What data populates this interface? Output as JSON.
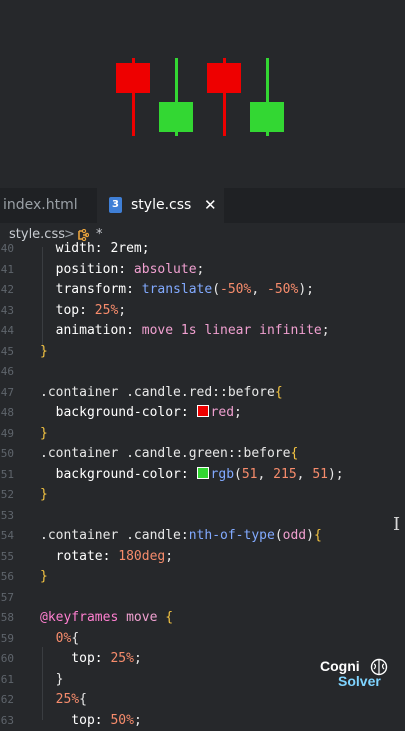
{
  "preview": {
    "colors": {
      "red": "#ee0000",
      "green": "#33d733",
      "background": "#26282b"
    },
    "candles": [
      {
        "color": "red",
        "level": 0.25
      },
      {
        "color": "green",
        "level": 0.75
      },
      {
        "color": "red",
        "level": 0.25
      },
      {
        "color": "green",
        "level": 0.75
      }
    ]
  },
  "tabs": [
    {
      "label": "index.html",
      "active": false
    },
    {
      "label": "style.css",
      "active": true,
      "icon": "css3-icon",
      "icon_text": "3",
      "close": "✕"
    }
  ],
  "breadcrumb": {
    "file": "style.css",
    "separator": ">",
    "symbol_icon": "selector-icon",
    "symbol": "*"
  },
  "editor": {
    "lines": [
      {
        "n": "40",
        "segs": [
          [
            "  width: 2rem;",
            "t-prop"
          ]
        ]
      },
      {
        "n": "41",
        "segs": [
          [
            "  position: ",
            "t-prop"
          ],
          [
            "absolute",
            "t-val"
          ],
          [
            ";",
            "t-punc"
          ]
        ]
      },
      {
        "n": "42",
        "segs": [
          [
            "  transform: ",
            "t-prop"
          ],
          [
            "translate",
            "t-fn"
          ],
          [
            "(",
            "t-punc"
          ],
          [
            "-50%",
            "t-num"
          ],
          [
            ", ",
            "t-punc"
          ],
          [
            "-50%",
            "t-num"
          ],
          [
            ");",
            "t-punc"
          ]
        ]
      },
      {
        "n": "43",
        "segs": [
          [
            "  top: ",
            "t-prop"
          ],
          [
            "25%",
            "t-num"
          ],
          [
            ";",
            "t-punc"
          ]
        ]
      },
      {
        "n": "44",
        "segs": [
          [
            "  animation: ",
            "t-prop"
          ],
          [
            "move 1s linear infinite",
            "t-val"
          ],
          [
            ";",
            "t-punc"
          ]
        ]
      },
      {
        "n": "45",
        "segs": [
          [
            "}",
            "t-brace"
          ]
        ]
      },
      {
        "n": "46",
        "segs": []
      },
      {
        "n": "47",
        "segs": [
          [
            ".container .candle.red::before",
            "t-sel"
          ],
          [
            "{",
            "t-brace"
          ]
        ]
      },
      {
        "n": "48",
        "segs": [
          [
            "  background-color: ",
            "t-prop"
          ],
          [
            "SWATCH:#ee0000",
            "swatch"
          ],
          [
            "red",
            "t-val"
          ],
          [
            ";",
            "t-punc"
          ]
        ]
      },
      {
        "n": "49",
        "segs": [
          [
            "}",
            "t-brace"
          ]
        ]
      },
      {
        "n": "50",
        "segs": [
          [
            ".container .candle.green::before",
            "t-sel"
          ],
          [
            "{",
            "t-brace"
          ]
        ]
      },
      {
        "n": "51",
        "segs": [
          [
            "  background-color: ",
            "t-prop"
          ],
          [
            "SWATCH:#33d733",
            "swatch"
          ],
          [
            "rgb",
            "t-fn"
          ],
          [
            "(",
            "t-punc"
          ],
          [
            "51",
            "t-num"
          ],
          [
            ", ",
            "t-punc"
          ],
          [
            "215",
            "t-num"
          ],
          [
            ", ",
            "t-punc"
          ],
          [
            "51",
            "t-num"
          ],
          [
            ");",
            "t-punc"
          ]
        ]
      },
      {
        "n": "52",
        "segs": [
          [
            "}",
            "t-brace"
          ]
        ]
      },
      {
        "n": "53",
        "segs": []
      },
      {
        "n": "54",
        "segs": [
          [
            ".container .candle:",
            "t-sel"
          ],
          [
            "nth-of-type",
            "t-fn"
          ],
          [
            "(",
            "t-punc"
          ],
          [
            "odd",
            "t-val"
          ],
          [
            ")",
            "t-punc"
          ],
          [
            "{",
            "t-brace"
          ]
        ]
      },
      {
        "n": "55",
        "segs": [
          [
            "  rotate: ",
            "t-prop"
          ],
          [
            "180deg",
            "t-num"
          ],
          [
            ";",
            "t-punc"
          ]
        ]
      },
      {
        "n": "56",
        "segs": [
          [
            "}",
            "t-brace"
          ]
        ]
      },
      {
        "n": "57",
        "segs": []
      },
      {
        "n": "58",
        "segs": [
          [
            "@keyframes",
            "t-kw"
          ],
          [
            " move ",
            "t-val"
          ],
          [
            "{",
            "t-brace"
          ]
        ]
      },
      {
        "n": "59",
        "segs": [
          [
            "  0%",
            "t-num"
          ],
          [
            "{",
            "t-punc"
          ]
        ]
      },
      {
        "n": "60",
        "segs": [
          [
            "    top: ",
            "t-prop"
          ],
          [
            "25%",
            "t-num"
          ],
          [
            ";",
            "t-punc"
          ]
        ]
      },
      {
        "n": "61",
        "segs": [
          [
            "  }",
            "t-punc"
          ]
        ]
      },
      {
        "n": "62",
        "segs": [
          [
            "  25%",
            "t-num"
          ],
          [
            "{",
            "t-punc"
          ]
        ]
      },
      {
        "n": "63",
        "segs": [
          [
            "    top: ",
            "t-prop"
          ],
          [
            "50%",
            "t-num"
          ],
          [
            ";",
            "t-punc"
          ]
        ]
      }
    ]
  },
  "watermark": {
    "line1": "Cogni",
    "line2": "Solver",
    "icon": "brain-icon"
  }
}
